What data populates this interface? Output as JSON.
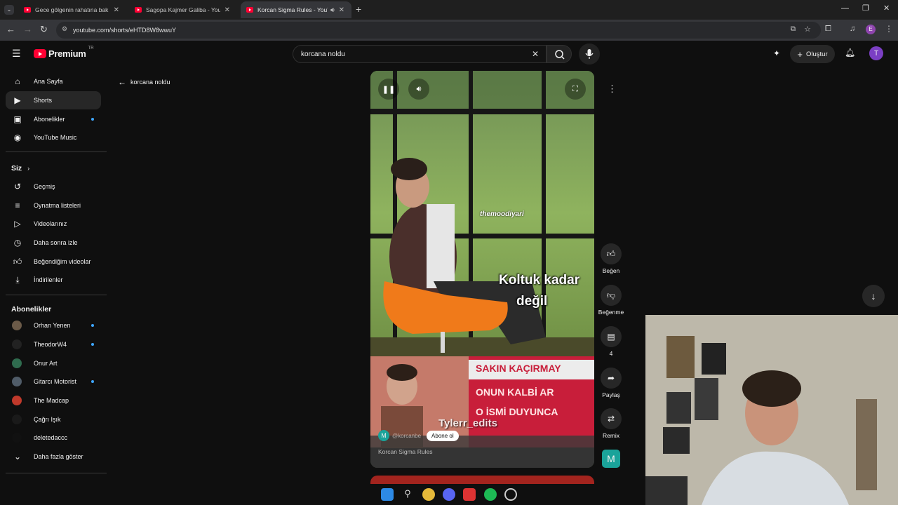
{
  "browser": {
    "tabs": [
      {
        "title": "Gece gölgenin rahatına bak kor",
        "active": false
      },
      {
        "title": "Sagopa Kajmer Galiba - YouTub",
        "active": false
      },
      {
        "title": "Korcan Sigma Rules - YouTu",
        "active": true
      }
    ],
    "new_tab": "+",
    "url": "youtube.com/shorts/eHTD8W8wwuY",
    "profile_letter": "E"
  },
  "header": {
    "logo_text": "Premium",
    "country": "TR",
    "search_value": "korcana noldu",
    "create_label": "Oluştur",
    "avatar_letter": "T"
  },
  "sidebar": {
    "main": [
      {
        "label": "Ana Sayfa",
        "icon": "home-icon"
      },
      {
        "label": "Shorts",
        "icon": "shorts-icon",
        "selected": true
      },
      {
        "label": "Abonelikler",
        "icon": "subscriptions-icon",
        "dot": true
      },
      {
        "label": "YouTube Music",
        "icon": "music-icon"
      }
    ],
    "you_header": "Siz",
    "you": [
      {
        "label": "Geçmiş",
        "icon": "history-icon"
      },
      {
        "label": "Oynatma listeleri",
        "icon": "playlist-icon"
      },
      {
        "label": "Videolarınız",
        "icon": "your-videos-icon"
      },
      {
        "label": "Daha sonra izle",
        "icon": "watch-later-icon"
      },
      {
        "label": "Beğendiğim videolar",
        "icon": "liked-icon"
      },
      {
        "label": "İndirilenler",
        "icon": "download-icon"
      }
    ],
    "subs_header": "Abonelikler",
    "subs": [
      {
        "label": "Orhan Yenen",
        "dot": true,
        "color": "#6b5a48"
      },
      {
        "label": "TheodorW4",
        "dot": true,
        "color": "#222222"
      },
      {
        "label": "Onur Art",
        "dot": false,
        "color": "#2f6b4e"
      },
      {
        "label": "Gitarcı Motorist",
        "dot": true,
        "color": "#505c68"
      },
      {
        "label": "The Madcap",
        "dot": false,
        "color": "#c0392b"
      },
      {
        "label": "Çağrı Işık",
        "dot": false,
        "color": "#1a1a1a"
      },
      {
        "label": "deletedaccc",
        "dot": false,
        "color": "#111111"
      }
    ],
    "show_more": "Daha fazla göster"
  },
  "back_link": "korcana noldu",
  "video": {
    "watermark": "themoodiyari",
    "caption_line1": "Koltuk kadar",
    "caption_line2": "değil",
    "banner_line1": "SAKIN KAÇIRMAY",
    "banner_line2": "ONUN KALBİ AR",
    "banner_line3": "O İSMİ DUYUNCA",
    "editor_tag": "Tylerr_edits",
    "channel_handle": "@korcanbe",
    "channel_letter": "M",
    "subscribe_label": "Abone ol",
    "video_title": "Korcan Sigma Rules"
  },
  "actions": {
    "like": "Beğen",
    "dislike": "Beğenme",
    "comments": "4",
    "share": "Paylaş",
    "remix": "Remix",
    "channel_letter": "M"
  },
  "colors": {
    "yt_red": "#ff0033",
    "accent_blue": "#3ea6ff",
    "avatar_purple": "#7b3fc4",
    "channel_teal": "#1aa39a"
  }
}
